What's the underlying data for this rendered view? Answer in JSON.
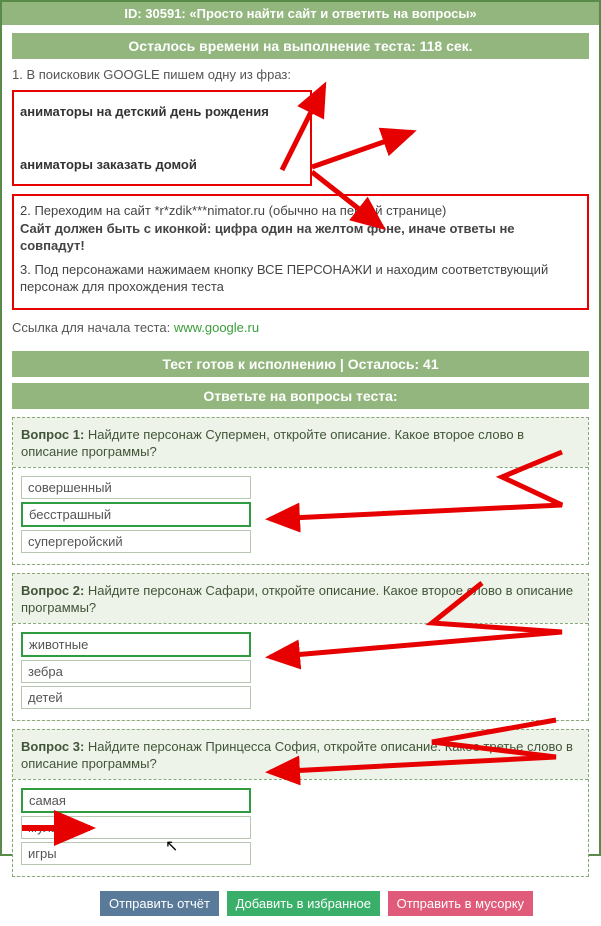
{
  "header": {
    "title": "ID: 30591: «Просто найти сайт и ответить на вопросы»"
  },
  "timer_bar": "Осталось времени на выполнение теста: 118 сек.",
  "instr1": "1. В поисковик GOOGLE пишем одну из фраз:",
  "phrases": {
    "p1": "аниматоры на детский день рождения",
    "p2": "аниматоры заказать домой"
  },
  "instr2": "2. Переходим на сайт *r*zdik***nimator.ru (обычно на первой странице)",
  "instr2b": "Сайт должен быть с иконкой: цифра один на желтом фоне, иначе ответы не совпадут!",
  "instr3": "3. Под персонажами нажимаем кнопку ВСЕ ПЕРСОНАЖИ и находим соответствующий персонаж для прохождения теста",
  "link_label": "Ссылка для начала теста: ",
  "link_url": "www.google.ru",
  "ready_bar": "Тест готов к исполнению | Осталось: 41",
  "answer_title": "Ответьте на вопросы теста:",
  "questions": [
    {
      "label": "Вопрос 1:",
      "text": " Найдите персонаж Супермен, откройте описание. Какое второе слово в описание программы?",
      "answers": [
        "совершенный",
        "бесстрашный",
        "супергеройский"
      ],
      "selected": 1
    },
    {
      "label": "Вопрос 2:",
      "text": " Найдите персонаж Сафари, откройте описание. Какое второе слово в описание программы?",
      "answers": [
        "животные",
        "зебра",
        "детей"
      ],
      "selected": 0
    },
    {
      "label": "Вопрос 3:",
      "text": " Найдите персонаж Принцесса София, откройте описание. Какое третье слово в описание программы?",
      "answers": [
        "самая",
        "мультик",
        "игры"
      ],
      "selected": 0
    }
  ],
  "buttons": {
    "submit": "Отправить отчёт",
    "fav": "Добавить в избранное",
    "trash": "Отправить в мусорку"
  }
}
